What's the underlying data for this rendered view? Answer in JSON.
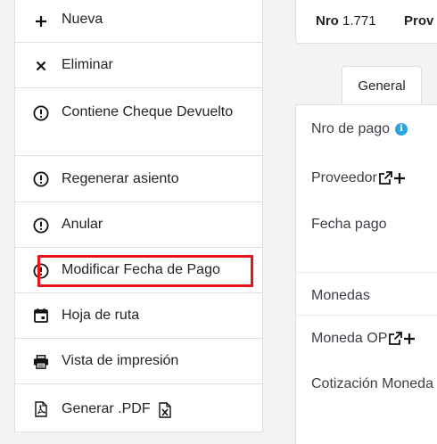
{
  "menu": {
    "items": [
      {
        "label": "Nueva",
        "icon": "plus-icon"
      },
      {
        "label": "Eliminar",
        "icon": "close-icon"
      },
      {
        "label": "Contiene Cheque Devuelto",
        "icon": "alert-circle-icon"
      },
      {
        "label": "Regenerar asiento",
        "icon": "alert-circle-icon"
      },
      {
        "label": "Anular",
        "icon": "alert-circle-icon"
      },
      {
        "label": "Modificar Fecha de Pago",
        "icon": "alert-circle-icon"
      },
      {
        "label": "Hoja de ruta",
        "icon": "calendar-icon"
      },
      {
        "label": "Vista de impresión",
        "icon": "printer-icon"
      },
      {
        "label": "Generar .PDF",
        "icon": "pdf-file-icon",
        "trailing_icon": "excel-file-icon"
      }
    ],
    "highlight_color": "#e8141b"
  },
  "header": {
    "nro_label": "Nro",
    "nro_value": "1.771",
    "prov_label": "Prov"
  },
  "tabs": [
    {
      "label": "General"
    }
  ],
  "form": {
    "nro_pago_label": "Nro de pago",
    "proveedor_label": "Proveedor",
    "fecha_pago_label": "Fecha pago",
    "monedas_label": "Monedas",
    "moneda_op_label": "Moneda OP",
    "cotizacion_label": "Cotización Moneda"
  },
  "colors": {
    "info": "#2aa3e0",
    "border": "#dcdfe4"
  }
}
